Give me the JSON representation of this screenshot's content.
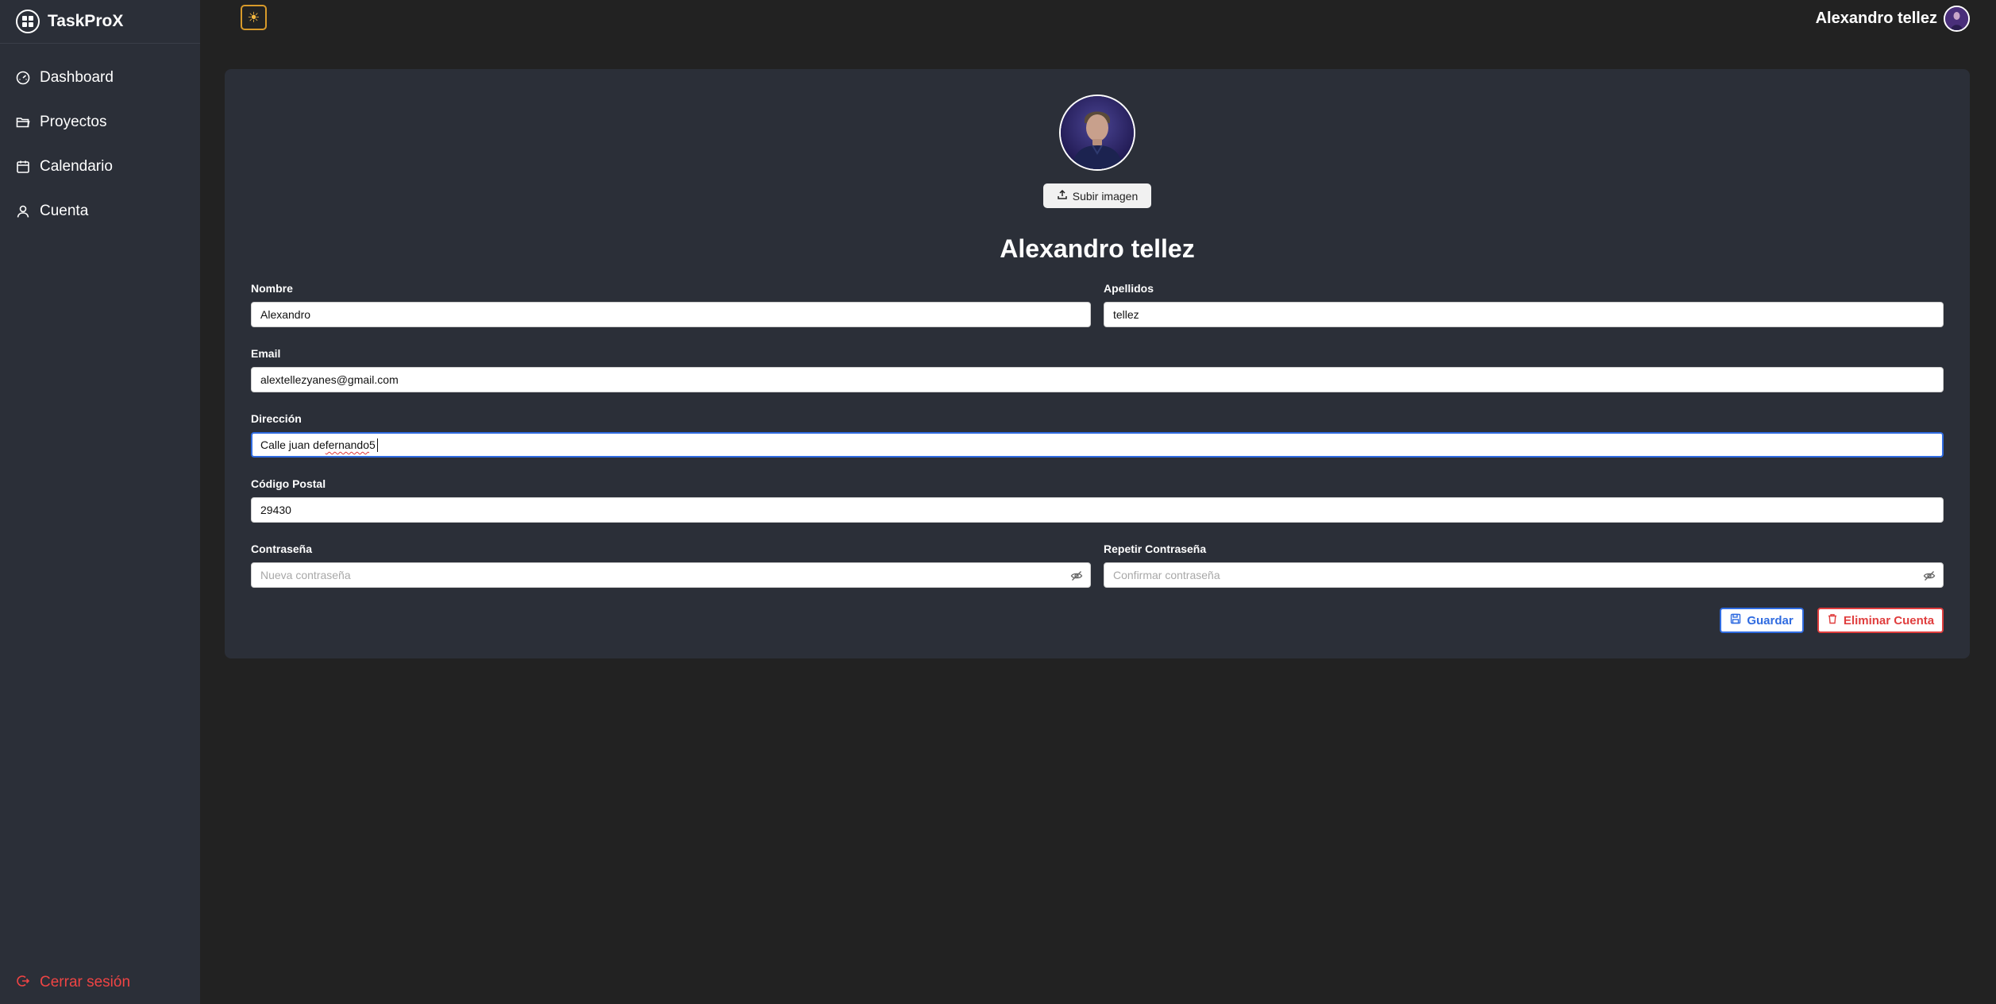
{
  "app": {
    "brand": "TaskProX"
  },
  "sidebar": {
    "items": [
      {
        "label": "Dashboard",
        "icon": "gauge-icon"
      },
      {
        "label": "Proyectos",
        "icon": "folder-icon"
      },
      {
        "label": "Calendario",
        "icon": "calendar-icon"
      },
      {
        "label": "Cuenta",
        "icon": "user-icon"
      }
    ],
    "logout_label": "Cerrar sesión"
  },
  "topbar": {
    "theme_icon": "sun-icon",
    "user_name": "Alexandro tellez"
  },
  "profile": {
    "upload_label": "Subir imagen",
    "full_name": "Alexandro tellez"
  },
  "form": {
    "nombre": {
      "label": "Nombre",
      "value": "Alexandro"
    },
    "apellidos": {
      "label": "Apellidos",
      "value": "tellez"
    },
    "email": {
      "label": "Email",
      "value": "alextellezyanes@gmail.com"
    },
    "direccion": {
      "label": "Dirección",
      "value_start": "Calle juan de ",
      "value_mis": "fernando",
      "value_end": " 5"
    },
    "codigo_postal": {
      "label": "Código Postal",
      "value": "29430"
    },
    "contrasena": {
      "label": "Contraseña",
      "placeholder": "Nueva contraseña"
    },
    "repetir_contrasena": {
      "label": "Repetir Contraseña",
      "placeholder": "Confirmar contraseña"
    }
  },
  "actions": {
    "save_label": "Guardar",
    "delete_label": "Eliminar Cuenta"
  },
  "colors": {
    "accent_blue": "#2f6be0",
    "danger_red": "#e03e3e",
    "theme_toggle": "#d89a2a",
    "sidebar_bg": "#2b2f38",
    "page_bg": "#222222"
  }
}
